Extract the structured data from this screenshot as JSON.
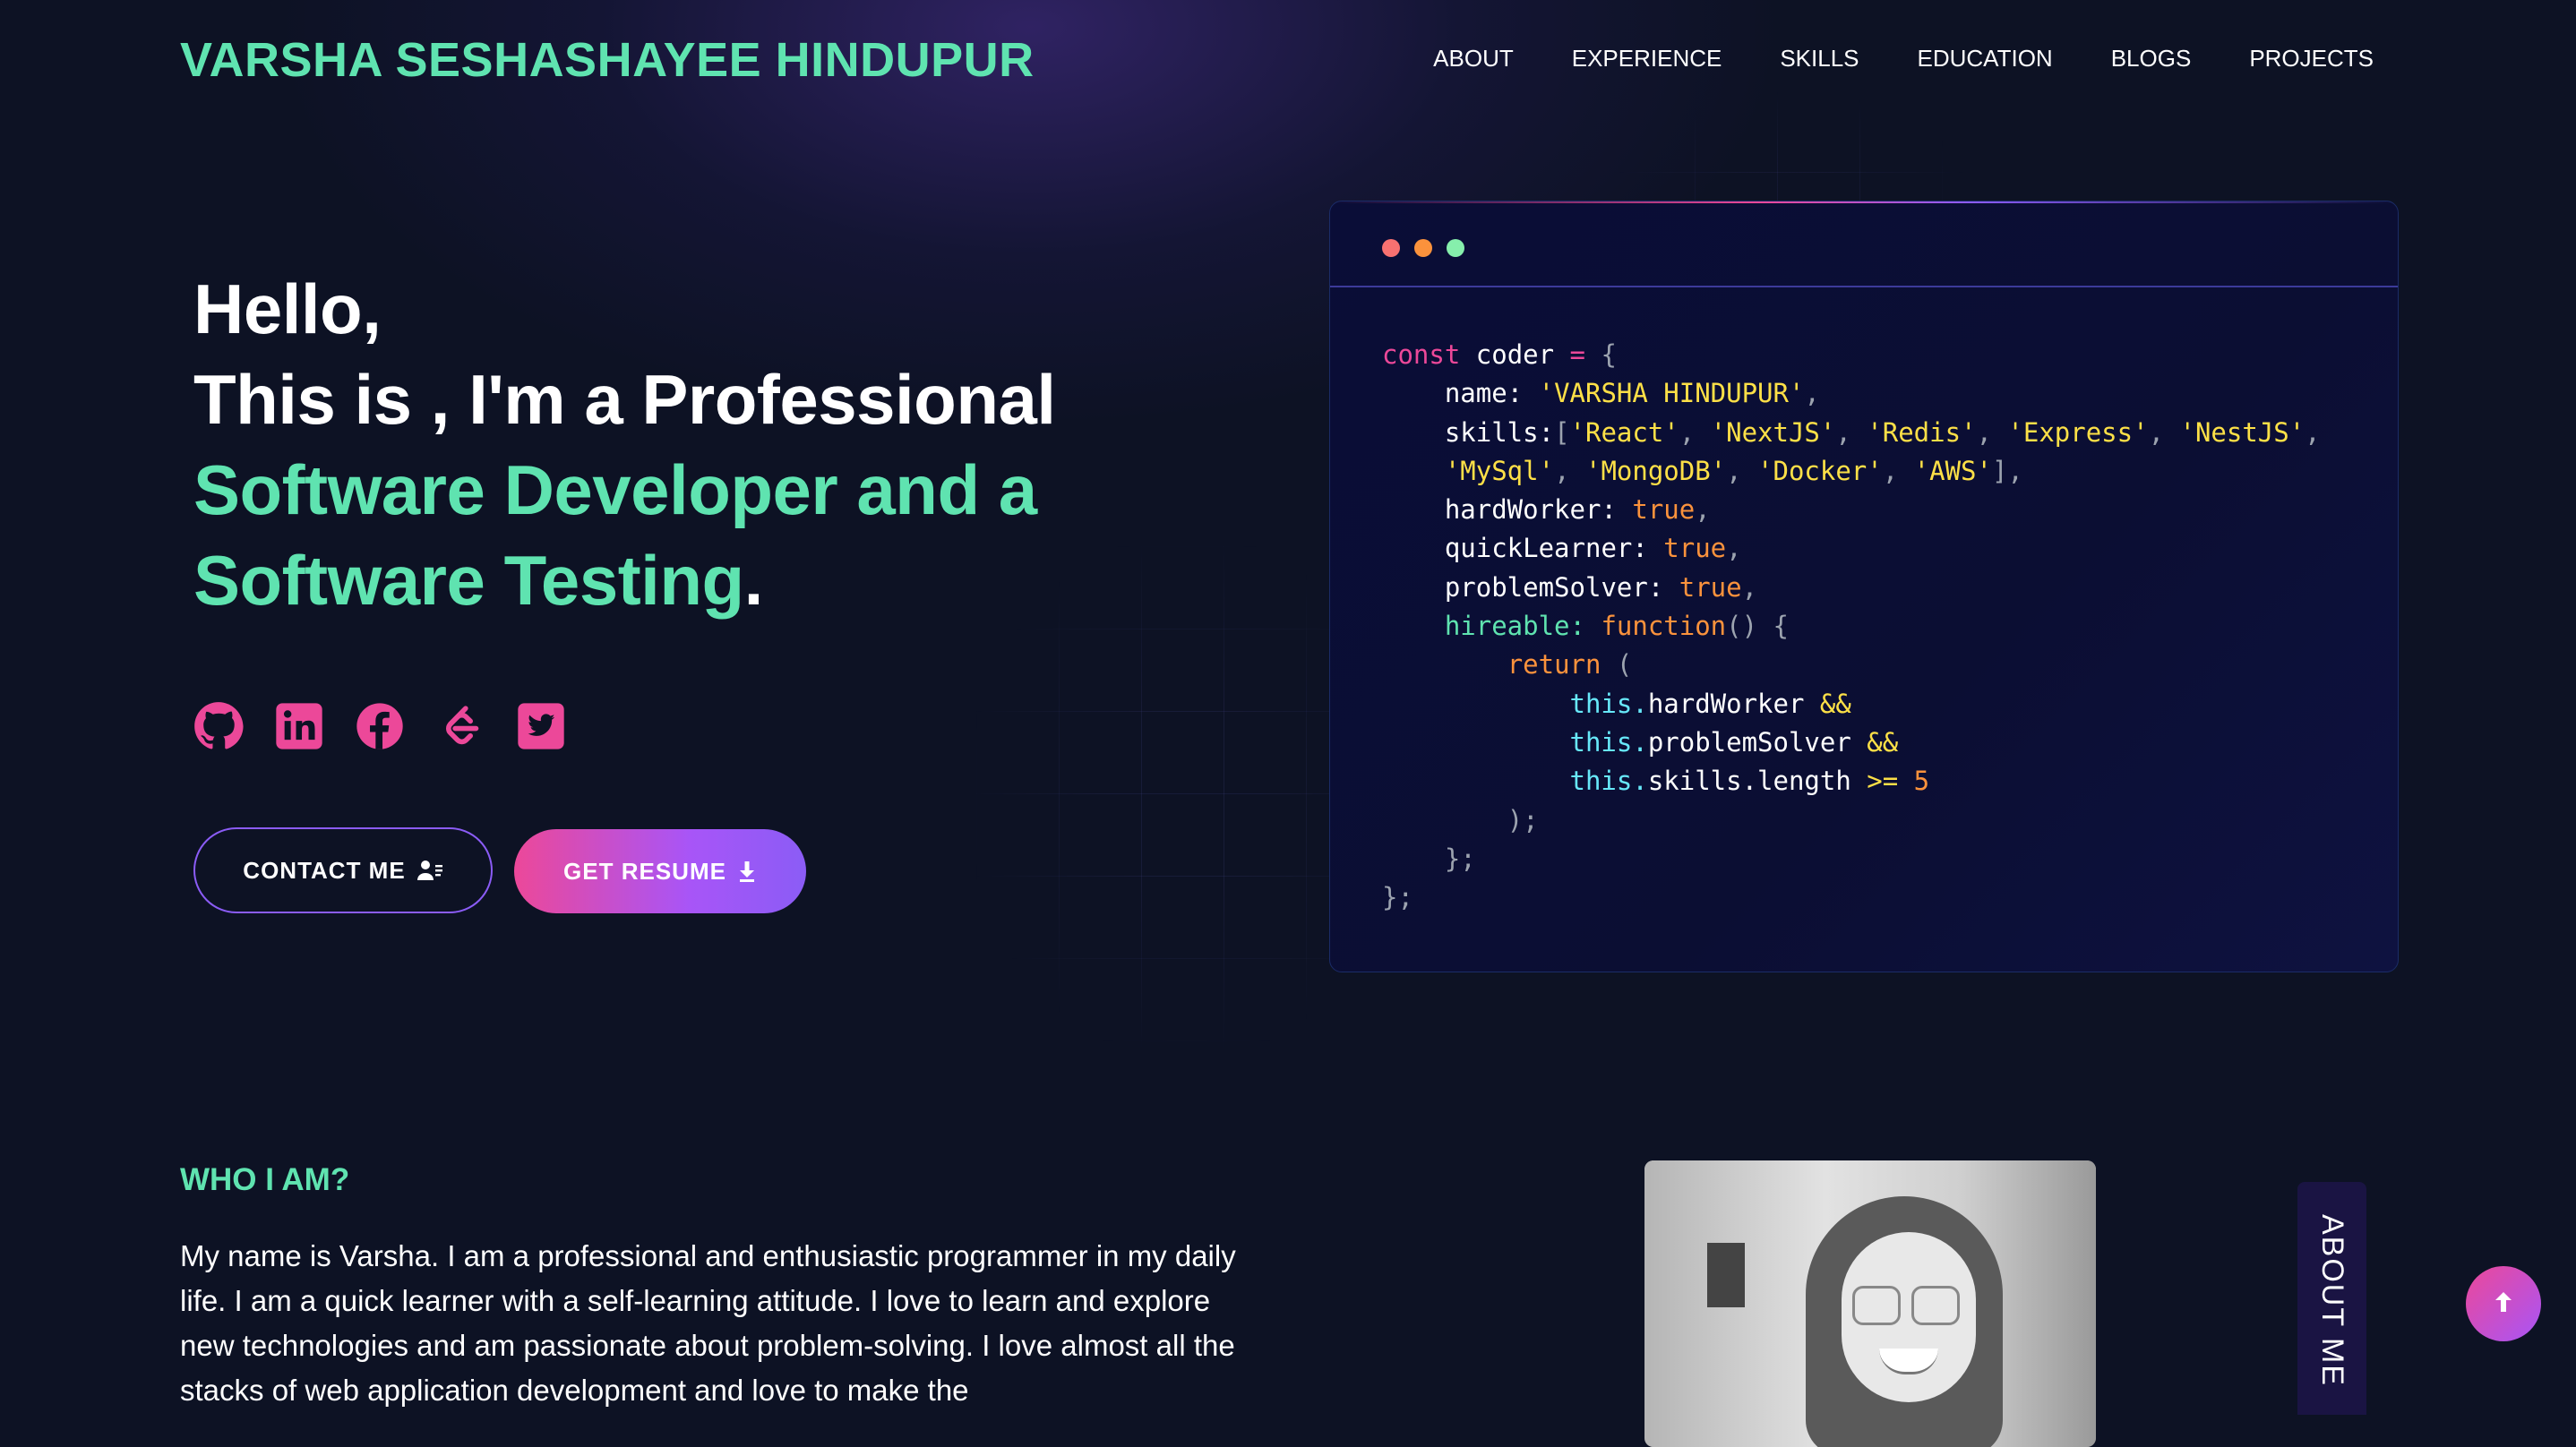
{
  "header": {
    "brand": "VARSHA SESHASHAYEE HINDUPUR",
    "nav": [
      {
        "label": "ABOUT"
      },
      {
        "label": "EXPERIENCE"
      },
      {
        "label": "SKILLS"
      },
      {
        "label": "EDUCATION"
      },
      {
        "label": "BLOGS"
      },
      {
        "label": "PROJECTS"
      }
    ]
  },
  "hero": {
    "line1": "Hello,",
    "line2": "This is , I'm a Professional",
    "line3": "Software Developer and a",
    "line4": "Software Testing",
    "period": ".",
    "socials": [
      {
        "icon": "github-icon"
      },
      {
        "icon": "linkedin-icon"
      },
      {
        "icon": "facebook-icon"
      },
      {
        "icon": "leetcode-icon"
      },
      {
        "icon": "twitter-icon"
      }
    ],
    "contact_label": "CONTACT ME",
    "resume_label": "GET RESUME"
  },
  "code": {
    "l1": {
      "kw": "const",
      "name": " coder ",
      "op": "=",
      "brace": " {"
    },
    "l2": {
      "key": "name: ",
      "val": "'VARSHA HINDUPUR'",
      "comma": ","
    },
    "l3": {
      "key": "skills:",
      "open": "[",
      "items": [
        "'React'",
        "'NextJS'",
        "'Redis'",
        "'Express'",
        "'NestJS'"
      ],
      "sep": ", ",
      "tail": ","
    },
    "l4": {
      "items": [
        "'MySql'",
        "'MongoDB'",
        "'Docker'",
        "'AWS'"
      ],
      "sep": ", ",
      "close": "],"
    },
    "l5": {
      "key": "hardWorker: ",
      "val": "true",
      "comma": ","
    },
    "l6": {
      "key": "quickLearner: ",
      "val": "true",
      "comma": ","
    },
    "l7": {
      "key": "problemSolver: ",
      "val": "true",
      "comma": ","
    },
    "l8": {
      "key": "hireable: ",
      "fn": "function",
      "rest": "() {"
    },
    "l9": {
      "kw": "return",
      "rest": " ("
    },
    "l10": {
      "this": "this.",
      "prop": "hardWorker ",
      "op": "&&"
    },
    "l11": {
      "this": "this.",
      "prop": "problemSolver ",
      "op": "&&"
    },
    "l12": {
      "this": "this.",
      "prop": "skills.length ",
      "op": ">=",
      "num": " 5"
    },
    "l13": ");",
    "l14": "};",
    "l15": "};"
  },
  "about": {
    "heading": "WHO I AM?",
    "paragraph": "My name is Varsha. I am a professional and enthusiastic programmer in my daily life. I am a quick learner with a self-learning attitude. I love to learn and explore new technologies and am passionate about problem-solving. I love almost all the stacks of web application development and love to make the",
    "side_tab": "ABOUT ME"
  },
  "colors": {
    "accent": "#5fe3b0",
    "pink": "#ec4899",
    "purple": "#8b5cf6",
    "background": "#0d1224"
  }
}
